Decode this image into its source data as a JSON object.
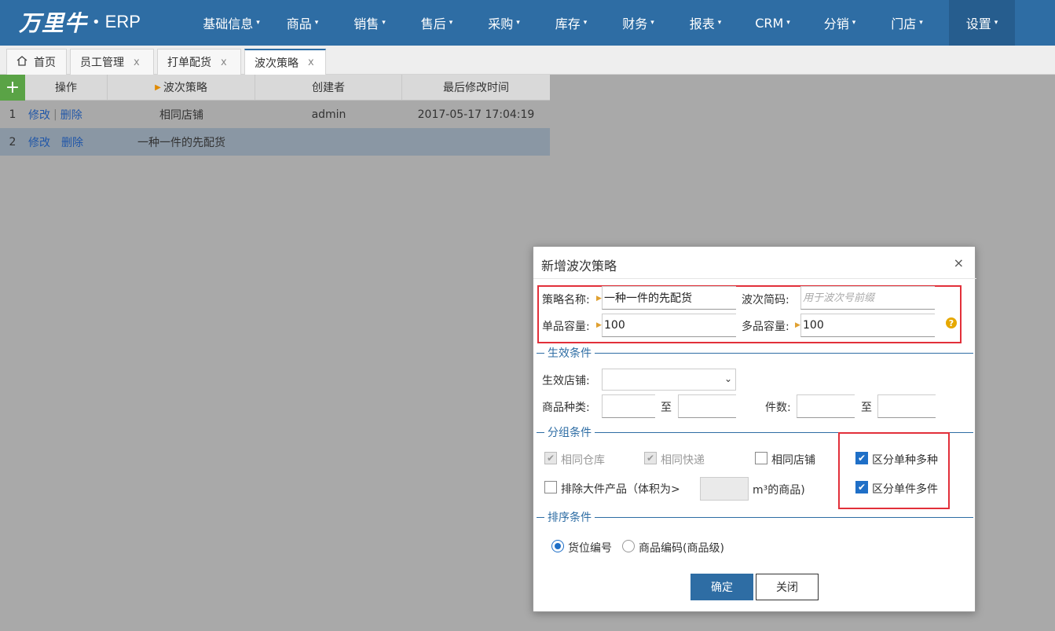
{
  "app": {
    "logo_mark": "万里牛",
    "logo_dot": "•",
    "logo_erp": "ERP"
  },
  "nav": [
    "基础信息",
    "商品",
    "销售",
    "售后",
    "采购",
    "库存",
    "财务",
    "报表",
    "CRM",
    "分销",
    "门店",
    "设置"
  ],
  "tabs": [
    {
      "label": "首页",
      "closable": false
    },
    {
      "label": "员工管理",
      "closable": true
    },
    {
      "label": "打单配货",
      "closable": true
    },
    {
      "label": "波次策略",
      "closable": true,
      "active": true
    }
  ],
  "tab_close_glyph": "x",
  "grid": {
    "add_label": "+",
    "headers": [
      "操作",
      "波次策略",
      "创建者",
      "最后修改时间"
    ],
    "rows": [
      {
        "no": "1",
        "edit": "修改",
        "sep": "|",
        "delete": "删除",
        "strategy": "相同店铺",
        "creator": "admin",
        "modified": "2017-05-17 17:04:19"
      },
      {
        "no": "2",
        "edit": "修改",
        "sep": "",
        "delete": "删除",
        "strategy": "一种一件的先配货",
        "creator": "",
        "modified": ""
      }
    ]
  },
  "modal": {
    "title": "新增波次策略",
    "close": "×",
    "fields": {
      "name_label": "策略名称:",
      "name_value": "一种一件的先配货",
      "code_label": "波次简码:",
      "code_placeholder": "用于波次号前缀",
      "single_label": "单品容量:",
      "single_value": "100",
      "multi_label": "多品容量:",
      "multi_value": "100",
      "help": "?"
    },
    "sections": {
      "effect": "生效条件",
      "group": "分组条件",
      "sort": "排序条件"
    },
    "effect": {
      "store_label": "生效店铺:",
      "store_value": "",
      "kinds_label": "商品种类:",
      "to1": "至",
      "count_label": "件数:",
      "to2": "至"
    },
    "group": {
      "same_warehouse": "相同仓库",
      "same_express": "相同快递",
      "same_store": "相同店铺",
      "distinguish_kinds": "区分单种多种",
      "exclude_large": "排除大件产品（体积为>",
      "volume_unit": "m³的商品)",
      "distinguish_pieces": "区分单件多件",
      "checks": {
        "same_warehouse": true,
        "same_express": true,
        "same_store": false,
        "distinguish_kinds": true,
        "exclude_large": false,
        "distinguish_pieces": true
      }
    },
    "sort": {
      "option1": "货位编号",
      "option2": "商品编码(商品级)",
      "selected": "option1"
    },
    "buttons": {
      "ok": "确定",
      "close": "关闭"
    }
  },
  "colors": {
    "topbar": "#2e6da4",
    "highlight_box": "#e2303a",
    "add_button": "#5aa346",
    "checkbox": "#1f6fc7",
    "overlay": "#a9a9a9"
  },
  "icons": {
    "home": "home-icon",
    "caret": "caret-down-icon",
    "help": "help-icon",
    "check": "check-icon"
  }
}
